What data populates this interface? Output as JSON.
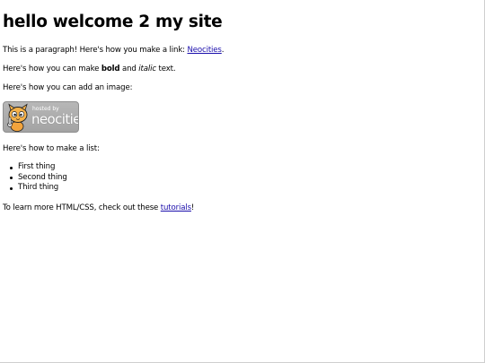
{
  "heading": "hello welcome 2 my site",
  "intro": {
    "text_before": "This is a paragraph! Here's how you make a link: ",
    "link_label": "Neocities",
    "text_after": "."
  },
  "formatting": {
    "text_before": "Here's how you can make ",
    "bold_word": "bold",
    "text_middle": " and ",
    "italic_word": "italic",
    "text_after": " text."
  },
  "image_intro": "Here's how you can add an image:",
  "badge": {
    "small_text": "hosted by",
    "brand_text": "neocities",
    "icon": "neocities-cat-icon"
  },
  "list_intro": "Here's how to make a list:",
  "list_items": [
    "First thing",
    "Second thing",
    "Third thing"
  ],
  "outro": {
    "text_before": "To learn more HTML/CSS, check out these ",
    "link_label": "tutorials",
    "text_after": "!"
  },
  "colors": {
    "link": "#1a0dab",
    "badge_bg": "#a9a9a9",
    "text": "#000000"
  }
}
